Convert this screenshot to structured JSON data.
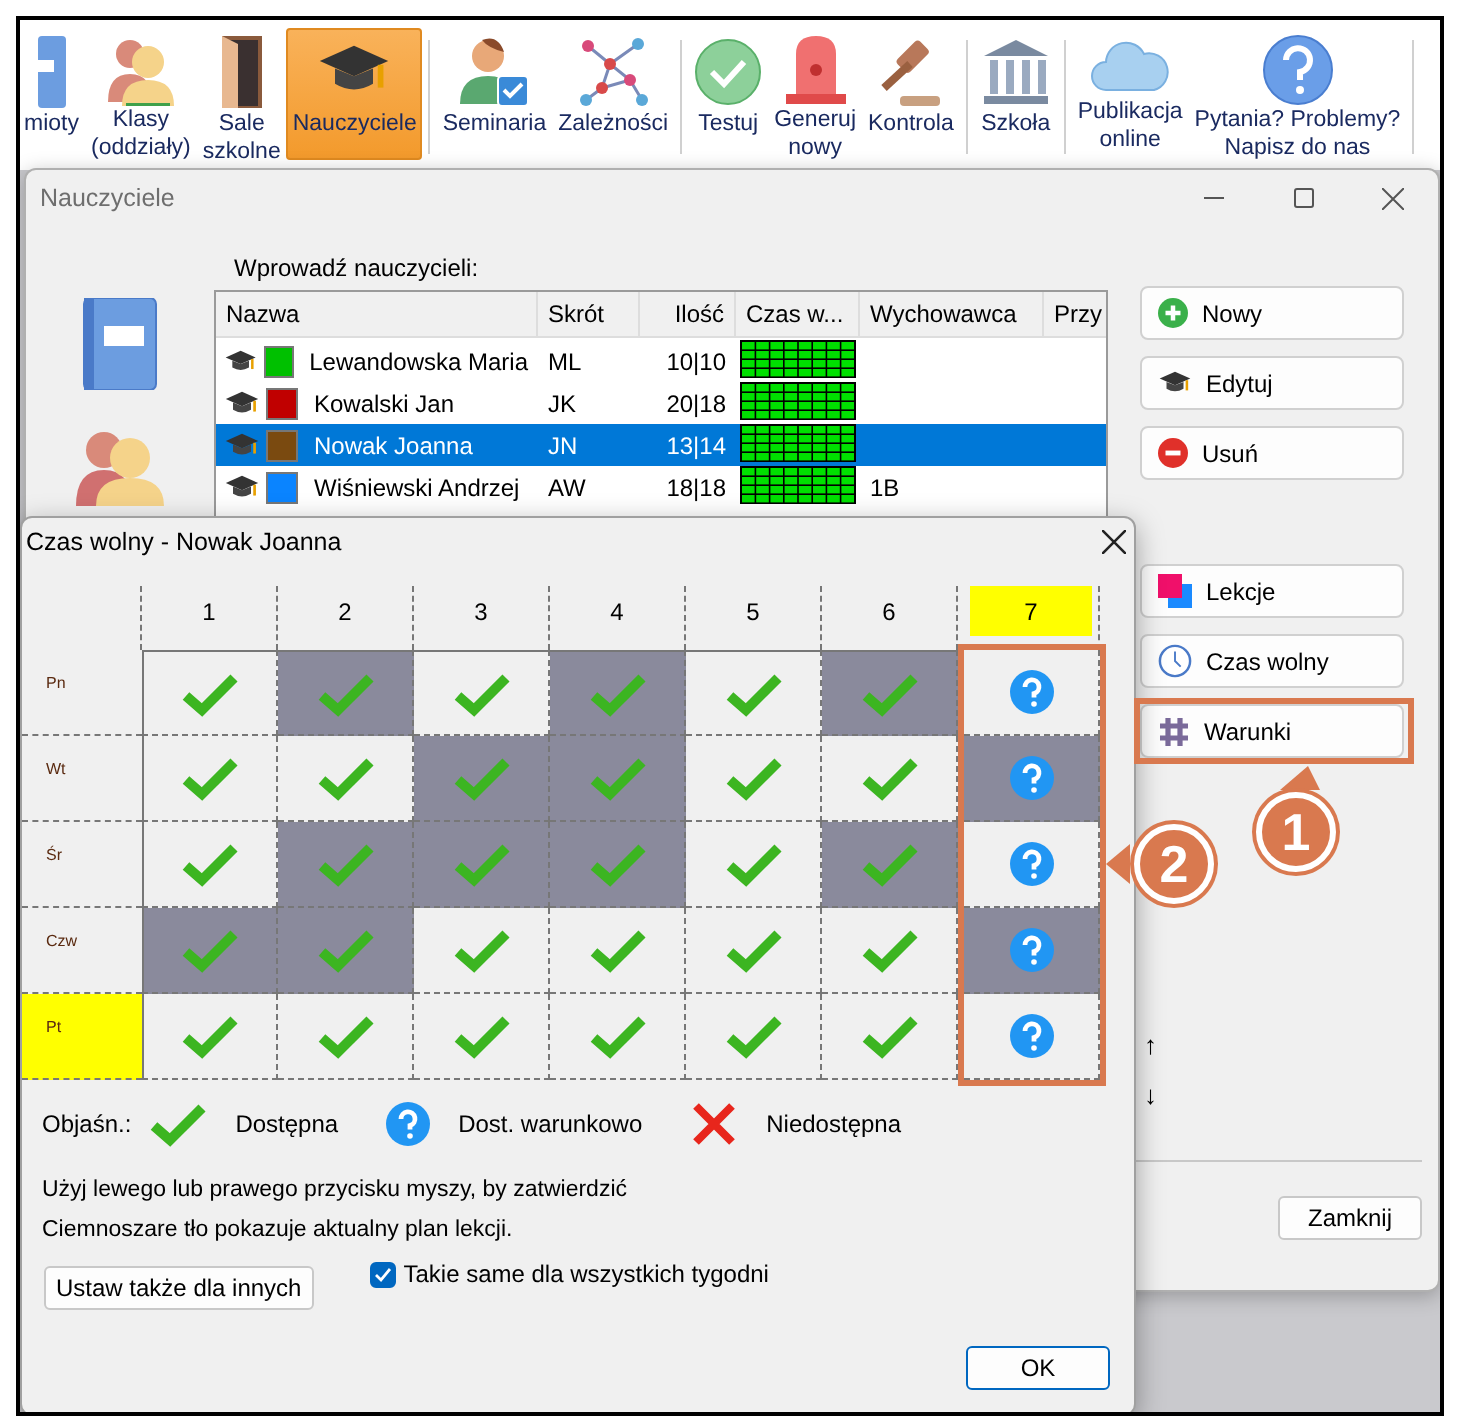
{
  "toolbar": {
    "groups": [
      [
        {
          "label": "mioty",
          "selected": false
        },
        {
          "label": "Klasy\n(oddziały)",
          "selected": false
        },
        {
          "label": "Sale\nszkolne",
          "selected": false
        },
        {
          "label": "Nauczyciele",
          "selected": true
        }
      ],
      [
        {
          "label": "Seminaria",
          "selected": false
        },
        {
          "label": "Zależności",
          "selected": false
        }
      ],
      [
        {
          "label": "Testuj",
          "selected": false
        },
        {
          "label": "Generuj\nnowy",
          "selected": false
        },
        {
          "label": "Kontrola",
          "selected": false
        }
      ],
      [
        {
          "label": "Szkoła",
          "selected": false
        }
      ],
      [
        {
          "label": "Publikacja\nonline",
          "selected": false
        },
        {
          "label": "Pytania? Problemy?\nNapisz do nas",
          "selected": false
        }
      ]
    ]
  },
  "teachers_window": {
    "title": "Nauczyciele",
    "list_label": "Wprowadź nauczycieli:",
    "table": {
      "columns": [
        "Nazwa",
        "Skrót",
        "Ilość",
        "Czas w...",
        "Wychowawca",
        "Przy"
      ],
      "rows": [
        {
          "name": "Lewandowska Maria",
          "abbr": "ML",
          "count": "10|10",
          "color": "#00c000",
          "class": "",
          "selected": false
        },
        {
          "name": "Kowalski Jan",
          "abbr": "JK",
          "count": "20|18",
          "color": "#c00000",
          "class": "",
          "selected": false
        },
        {
          "name": "Nowak Joanna",
          "abbr": "JN",
          "count": "13|14",
          "color": "#7a4a10",
          "class": "",
          "selected": true
        },
        {
          "name": "Wiśniewski Andrzej",
          "abbr": "AW",
          "count": "18|18",
          "color": "#0a84ff",
          "class": "1B",
          "selected": false
        }
      ]
    },
    "buttons": [
      {
        "label": "Nowy",
        "kind": "new"
      },
      {
        "label": "Edytuj",
        "kind": "edit"
      },
      {
        "label": "Usuń",
        "kind": "delete"
      }
    ],
    "buttons_2": [
      {
        "label": "Lekcje",
        "kind": "lessons"
      },
      {
        "label": "Czas wolny",
        "kind": "time"
      },
      {
        "label": "Warunki",
        "kind": "conditions"
      }
    ],
    "arrows": [
      "↑",
      "↓"
    ],
    "close_button": "Zamknij"
  },
  "dialog": {
    "title": "Czas wolny - Nowak Joanna",
    "columns": [
      {
        "label": "1",
        "highlighted": false
      },
      {
        "label": "2",
        "highlighted": false
      },
      {
        "label": "3",
        "highlighted": false
      },
      {
        "label": "4",
        "highlighted": false
      },
      {
        "label": "5",
        "highlighted": false
      },
      {
        "label": "6",
        "highlighted": false
      },
      {
        "label": "7",
        "highlighted": true
      }
    ],
    "rows": [
      {
        "day": "Pn",
        "highlighted": false,
        "cells": [
          {
            "kind": "available",
            "busy": false
          },
          {
            "kind": "available",
            "busy": true
          },
          {
            "kind": "available",
            "busy": false
          },
          {
            "kind": "available",
            "busy": true
          },
          {
            "kind": "available",
            "busy": false
          },
          {
            "kind": "available",
            "busy": true
          },
          {
            "kind": "conditional",
            "busy": false
          }
        ]
      },
      {
        "day": "Wt",
        "highlighted": false,
        "cells": [
          {
            "kind": "available",
            "busy": false
          },
          {
            "kind": "available",
            "busy": false
          },
          {
            "kind": "available",
            "busy": true
          },
          {
            "kind": "available",
            "busy": true
          },
          {
            "kind": "available",
            "busy": false
          },
          {
            "kind": "available",
            "busy": false
          },
          {
            "kind": "conditional",
            "busy": true
          }
        ]
      },
      {
        "day": "Śr",
        "highlighted": false,
        "cells": [
          {
            "kind": "available",
            "busy": false
          },
          {
            "kind": "available",
            "busy": true
          },
          {
            "kind": "available",
            "busy": true
          },
          {
            "kind": "available",
            "busy": true
          },
          {
            "kind": "available",
            "busy": false
          },
          {
            "kind": "available",
            "busy": true
          },
          {
            "kind": "conditional",
            "busy": false
          }
        ]
      },
      {
        "day": "Czw",
        "highlighted": false,
        "cells": [
          {
            "kind": "available",
            "busy": true
          },
          {
            "kind": "available",
            "busy": true
          },
          {
            "kind": "available",
            "busy": false
          },
          {
            "kind": "available",
            "busy": false
          },
          {
            "kind": "available",
            "busy": false
          },
          {
            "kind": "available",
            "busy": false
          },
          {
            "kind": "conditional",
            "busy": true
          }
        ]
      },
      {
        "day": "Pt",
        "highlighted": true,
        "cells": [
          {
            "kind": "available",
            "busy": false
          },
          {
            "kind": "available",
            "busy": false
          },
          {
            "kind": "available",
            "busy": false
          },
          {
            "kind": "available",
            "busy": false
          },
          {
            "kind": "available",
            "busy": false
          },
          {
            "kind": "available",
            "busy": false
          },
          {
            "kind": "conditional",
            "busy": false
          }
        ]
      }
    ],
    "legend_label": "Objaśn.:",
    "legend": [
      {
        "kind": "available",
        "label": "Dostępna"
      },
      {
        "kind": "conditional",
        "label": "Dost. warunkowo"
      },
      {
        "kind": "unavailable",
        "label": "Niedostępna"
      }
    ],
    "hints": [
      "Użyj lewego lub prawego przycisku myszy, by zatwierdzić",
      "Ciemnoszare tło pokazuje aktualny plan lekcji."
    ],
    "apply_button": "Ustaw także dla innych",
    "same_weeks": {
      "label": "Takie same dla wszystkich tygodni",
      "checked": true
    },
    "ok_button": "OK"
  },
  "annotations": [
    {
      "label": "1"
    },
    {
      "label": "2"
    }
  ]
}
